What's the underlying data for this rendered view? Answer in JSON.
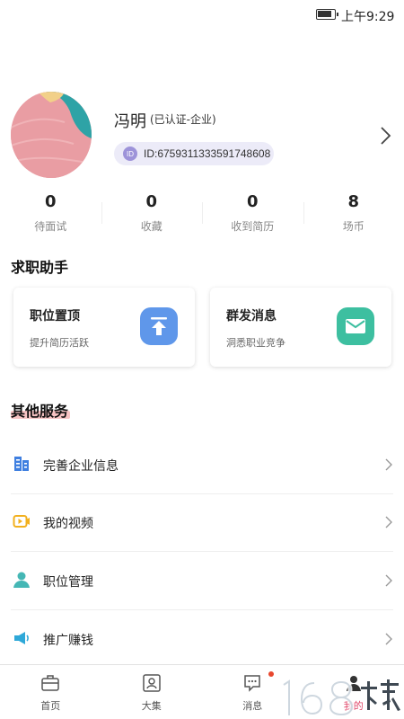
{
  "status_bar": {
    "time": "上午9:29"
  },
  "profile": {
    "name": "冯明",
    "badge": "(已认证-企业)",
    "id_icon": "ID",
    "id_text": "ID:6759311333591748608"
  },
  "stats": [
    {
      "value": "0",
      "label": "待面试"
    },
    {
      "value": "0",
      "label": "收藏"
    },
    {
      "value": "0",
      "label": "收到简历"
    },
    {
      "value": "8",
      "label": "场币"
    }
  ],
  "job_helper": {
    "title": "求职助手",
    "cards": [
      {
        "title": "职位置顶",
        "subtitle": "提升简历活跃",
        "icon": "arrow-up-top-icon",
        "color": "#5f97ea"
      },
      {
        "title": "群发消息",
        "subtitle": "洞悉职业竞争",
        "icon": "envelope-icon",
        "color": "#3dbfa0"
      }
    ]
  },
  "other_services": {
    "title": "其他服务",
    "items": [
      {
        "label": "完善企业信息",
        "icon": "building-icon",
        "color": "#3f7fe0"
      },
      {
        "label": "我的视频",
        "icon": "video-icon",
        "color": "#f2b01e"
      },
      {
        "label": "职位管理",
        "icon": "person-icon",
        "color": "#45b7b5"
      },
      {
        "label": "推广赚钱",
        "icon": "megaphone-icon",
        "color": "#2ea8d8"
      }
    ]
  },
  "bottom_nav": {
    "items": [
      {
        "label": "首页",
        "icon": "briefcase-icon"
      },
      {
        "label": "大集",
        "icon": "contact-card-icon"
      },
      {
        "label": "消息",
        "icon": "chat-bubble-icon"
      },
      {
        "label": "我的",
        "icon": "profile-icon",
        "active": true
      }
    ]
  },
  "accent_color": "#e0486a"
}
